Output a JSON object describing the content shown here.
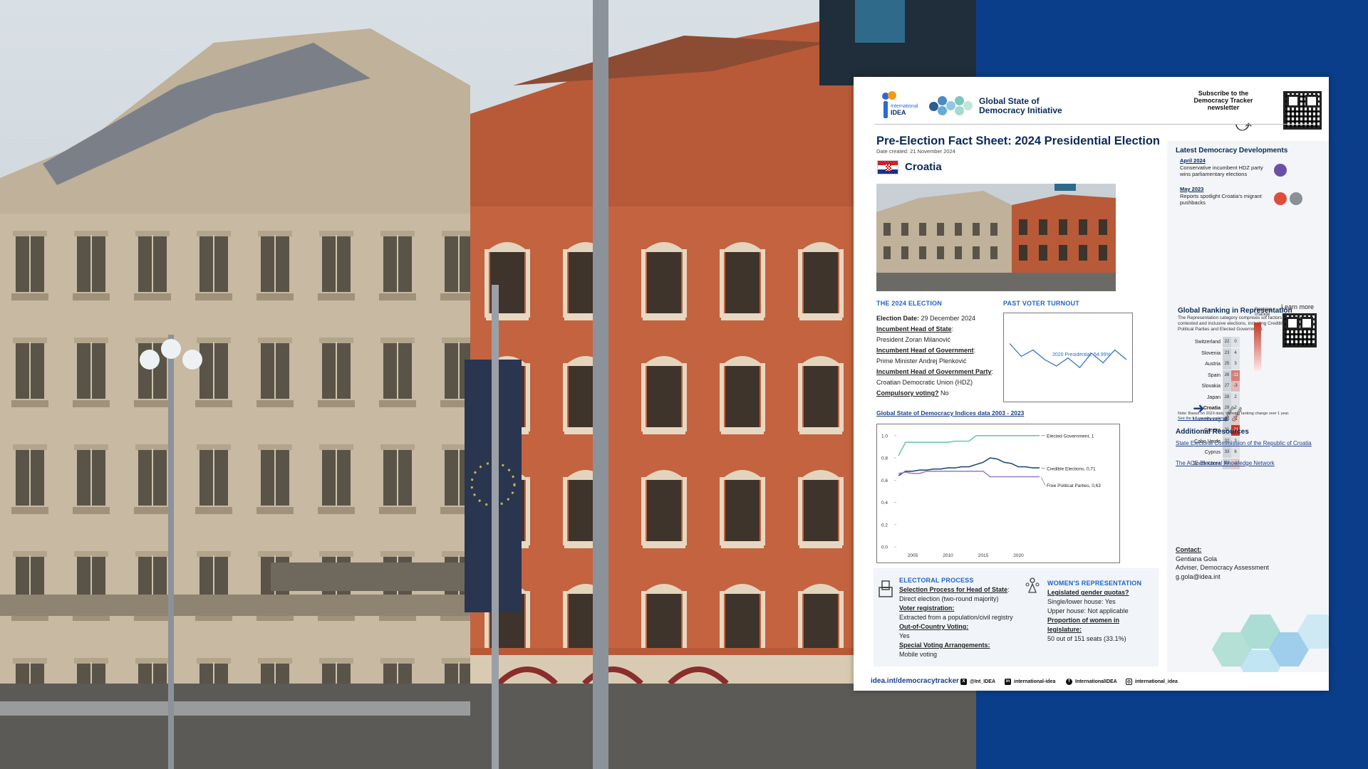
{
  "sheet": {
    "org_name_top": "International",
    "org_name_bottom": "IDEA",
    "initiative": "Global State of Democracy Initiative",
    "subscribe": "Subscribe to the Democracy Tracker newsletter",
    "title": "Pre-Election Fact Sheet: 2024 Presidential Election",
    "date_created": "Date created: 21 November 2024",
    "country": "Croatia",
    "colors": {
      "accent": "#1d64c8",
      "navy": "#0a2a5a",
      "background_blue": "#0a3e8a"
    }
  },
  "election": {
    "heading": "THE 2024 ELECTION",
    "date_label": "Election Date:",
    "date_value": " 29 December 2024",
    "hos_label": "Incumbent Head of State",
    "hos_value": "President Zoran Milanović",
    "hog_label": "Incumbent Head of Government",
    "hog_value": "Prime Minister Andrej Plenković",
    "party_label": "Incumbent Head of Government Party",
    "party_value": "Croatian Democratic Union (HDZ)",
    "compulsory_label": "Compulsory voting?",
    "compulsory_value": " No"
  },
  "turnout": {
    "heading": "PAST VOTER TURNOUT",
    "label": "2020 Presidential, 54.99%"
  },
  "indices": {
    "link": "Global State of Democracy Indices data 2003 - 2023"
  },
  "chart_data": [
    {
      "type": "line",
      "series": [
        {
          "name": "2020 Presidential",
          "values": [
            0.7,
            0.62,
            0.66,
            0.6,
            0.56,
            0.61,
            0.55,
            0.64,
            0.58,
            0.66,
            0.6
          ]
        }
      ],
      "annotation": "2020 Presidential, 54.99%"
    },
    {
      "type": "line",
      "x": [
        2003,
        2004,
        2005,
        2006,
        2007,
        2008,
        2009,
        2010,
        2011,
        2012,
        2013,
        2014,
        2015,
        2016,
        2017,
        2018,
        2019,
        2020,
        2021,
        2022,
        2023
      ],
      "xticks": [
        "2005",
        "2010",
        "2015",
        "2020"
      ],
      "yticks": [
        "0.0",
        "0.2",
        "0.4",
        "0.6",
        "0.8",
        "1.0"
      ],
      "ylim": [
        0,
        1.05
      ],
      "series": [
        {
          "name": "Elected Government, 1",
          "color": "#6ac9b0",
          "values": [
            0.82,
            0.94,
            0.94,
            0.94,
            0.94,
            0.94,
            0.94,
            0.94,
            0.95,
            0.95,
            0.95,
            1,
            1,
            1,
            1,
            1,
            1,
            1,
            1,
            1,
            1
          ]
        },
        {
          "name": "Credible Elections, 0,71",
          "color": "#1e4e7a",
          "values": [
            0.64,
            0.68,
            0.68,
            0.69,
            0.69,
            0.7,
            0.7,
            0.71,
            0.71,
            0.72,
            0.72,
            0.74,
            0.76,
            0.8,
            0.79,
            0.76,
            0.75,
            0.72,
            0.72,
            0.71,
            0.71
          ]
        },
        {
          "name": "Free Political Parties, 0,63",
          "color": "#9a84c8",
          "values": [
            0.66,
            0.67,
            0.66,
            0.66,
            0.68,
            0.68,
            0.68,
            0.68,
            0.68,
            0.68,
            0.68,
            0.68,
            0.68,
            0.63,
            0.63,
            0.63,
            0.63,
            0.63,
            0.63,
            0.63,
            0.63
          ]
        }
      ]
    }
  ],
  "electoral": {
    "heading": "ELECTORAL PROCESS",
    "sel_label": "Selection Process for Head of State",
    "sel_value": "Direct election (two-round majority)",
    "reg_label": "Voter registration:",
    "reg_value": "Extracted from a population/civil registry",
    "ooc_label": "Out-of-Country Voting:",
    "ooc_value": "Yes",
    "sva_label": "Special Voting Arrangements:",
    "sva_value": "Mobile voting"
  },
  "women": {
    "heading": "WOMEN'S REPRESENTATION",
    "quota_label": "Legislated gender quotas?",
    "lower": "Single/lower house: Yes",
    "upper": "Upper house: Not applicable",
    "prop_label": "Proportion of women in legislature:",
    "prop_value": "50 out of 151 seats (33.1%)"
  },
  "developments": {
    "heading": "Latest Democracy Developments",
    "items": [
      {
        "date": "April 2024",
        "text": "Conservative incumbent HDZ party wins parliamentary elections"
      },
      {
        "date": "May 2023",
        "text": "Reports spotlight Croatia's migrant pushbacks"
      }
    ]
  },
  "ranking": {
    "heading": "Global Ranking in Representation",
    "desc": "The Representation category comprises six factors to measure contested and inclusive elections, including Credible Elections, Free Political Parties and Elected Government.",
    "rows": [
      {
        "country": "Switzerland",
        "rank": "22",
        "change": "0"
      },
      {
        "country": "Slovenia",
        "rank": "23",
        "change": "4"
      },
      {
        "country": "Austria",
        "rank": "25",
        "change": "3"
      },
      {
        "country": "Spain",
        "rank": "26",
        "change": "-11"
      },
      {
        "country": "Slovakia",
        "rank": "27",
        "change": "-3"
      },
      {
        "country": "Japan",
        "rank": "28",
        "change": "2"
      },
      {
        "country": "Croatia",
        "rank": "29",
        "change": "2"
      },
      {
        "country": "Luxembourg",
        "rank": "30",
        "change": "-1"
      },
      {
        "country": "Greece",
        "rank": "31",
        "change": "-21"
      },
      {
        "country": "Cabo Verde",
        "rank": "32",
        "change": "3"
      },
      {
        "country": "Cyprus",
        "rank": "33",
        "change": "6"
      },
      {
        "country": "South Korea",
        "rank": "34",
        "change": "-1"
      }
    ],
    "legend_label": "Ranking change",
    "learn_more": "Learn more",
    "col_rank": "Ranking",
    "col_change": "Change",
    "note": "Note: Based on 2023 data, showing ranking change over 1 year.",
    "note_link": "See the full country rankings."
  },
  "resources": {
    "heading": "Additional Resources",
    "items": [
      "State Electoral Commission of the Republic of Croatia",
      "The ACE Electoral Knowledge Network"
    ]
  },
  "contact": {
    "label": "Contact:",
    "name": "Gentiana Gola",
    "role": "Adviser, Democracy Assessment",
    "email": "g.gola@idea.int"
  },
  "footer": {
    "url": "idea.int/democracytracker",
    "x": "@Int_IDEA",
    "linkedin": "international-idea",
    "facebook": "InternationalIDEA",
    "instagram": "international_idea"
  }
}
